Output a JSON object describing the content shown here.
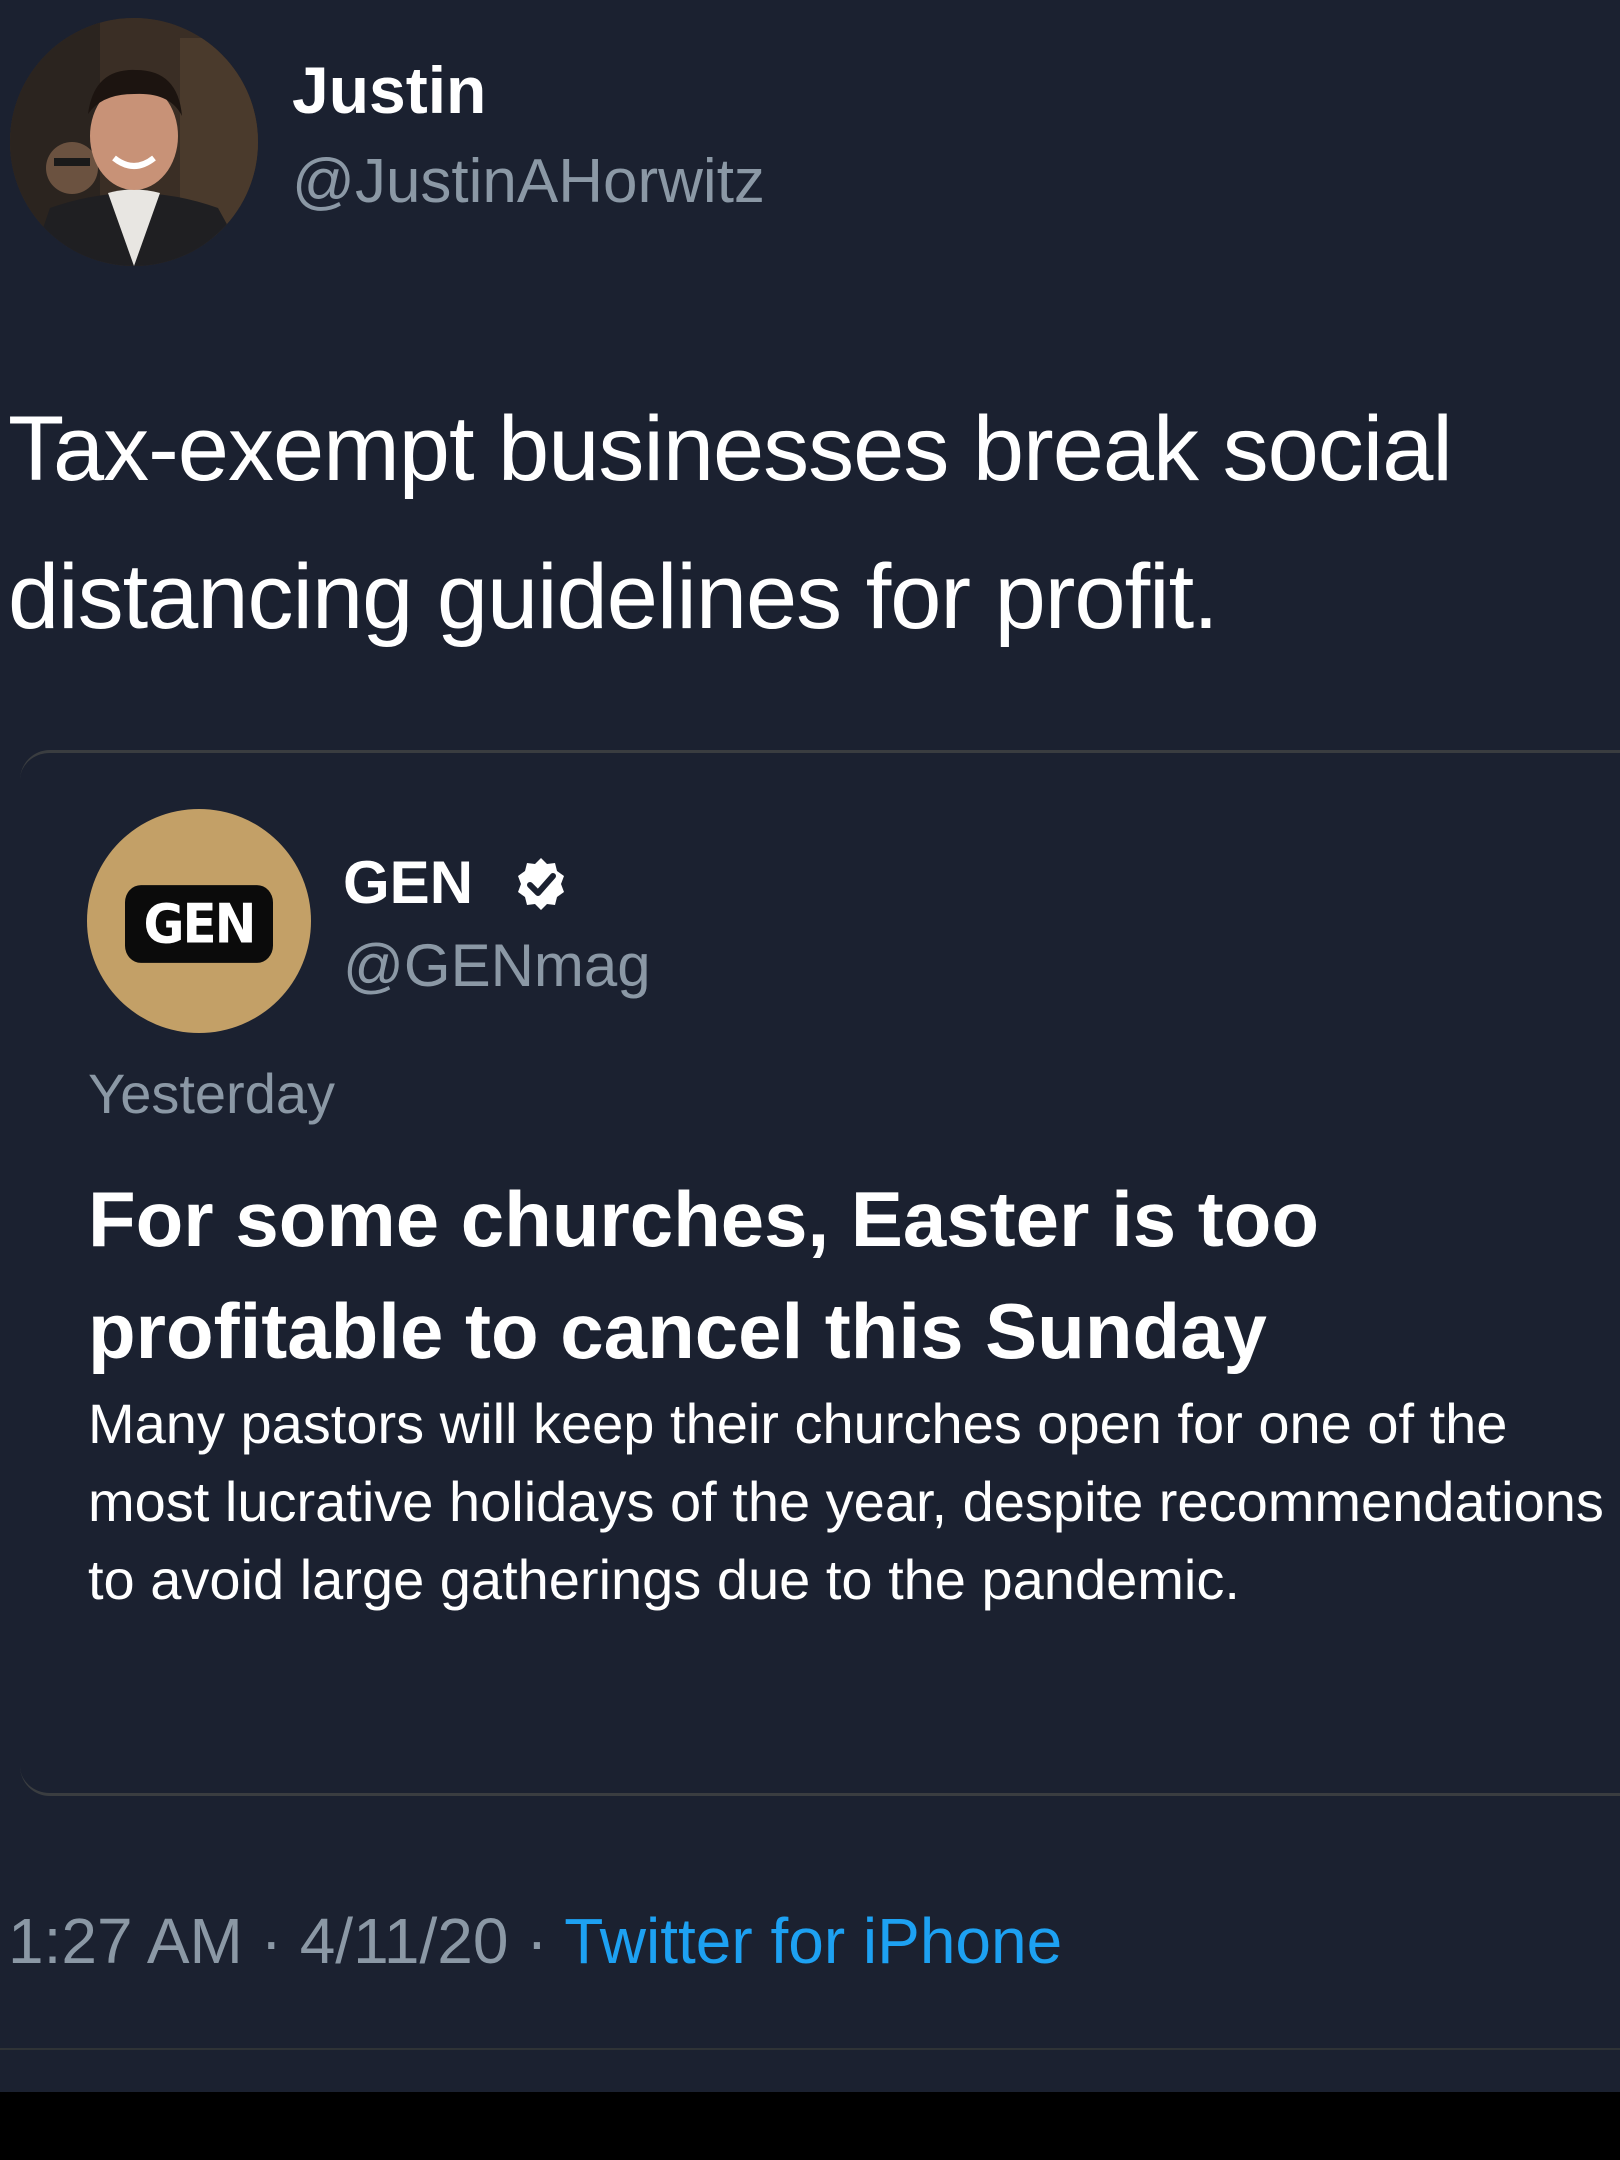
{
  "tweet": {
    "author": {
      "name": "Justin",
      "handle": "@JustinAHorwitz"
    },
    "text": "Tax-exempt businesses break social distancing guidelines for profit.",
    "quoted": {
      "avatar_badge": "GEN",
      "name": "GEN",
      "verified_icon": "verified-badge-icon",
      "handle": "@GENmag",
      "time": "Yesterday",
      "headline": "For some churches, Easter is too profitable to cancel this Sunday",
      "summary": "Many pastors will keep their churches open for one of the most lucrative holidays of the year, despite recommendations to avoid large gatherings due to the pandemic."
    },
    "meta": {
      "time": "1:27 AM",
      "separator": " · ",
      "date": "4/11/20",
      "source": "Twitter for iPhone"
    }
  },
  "colors": {
    "background": "#1b2130",
    "text": "#ffffff",
    "secondary_text": "#8b98a5",
    "link": "#1da1f2",
    "gen_avatar": "#c3a067"
  }
}
